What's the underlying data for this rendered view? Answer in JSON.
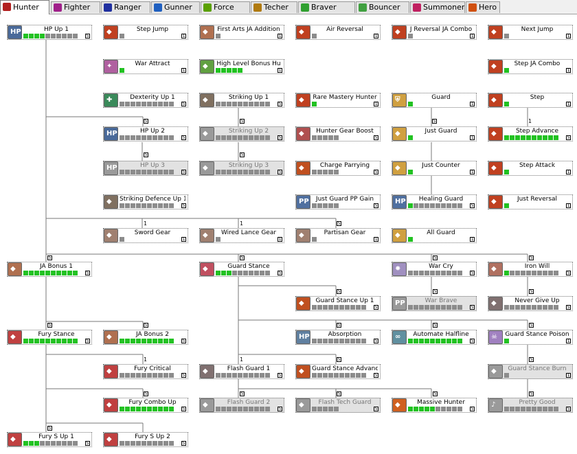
{
  "tabs": [
    {
      "label": "Hunter",
      "icon": "hunter-icon",
      "color": "#b22020",
      "active": true
    },
    {
      "label": "Fighter",
      "icon": "fighter-icon",
      "color": "#a0208a",
      "active": false
    },
    {
      "label": "Ranger",
      "icon": "ranger-icon",
      "color": "#2030a0",
      "active": false
    },
    {
      "label": "Gunner",
      "icon": "gunner-icon",
      "color": "#2060c0",
      "active": false
    },
    {
      "label": "Force",
      "icon": "force-icon",
      "color": "#5aa000",
      "active": false
    },
    {
      "label": "Techer",
      "icon": "techer-icon",
      "color": "#b07a10",
      "active": false
    },
    {
      "label": "Braver",
      "icon": "braver-icon",
      "color": "#30a030",
      "active": false
    },
    {
      "label": "Bouncer",
      "icon": "bouncer-icon",
      "color": "#40a040",
      "active": false
    },
    {
      "label": "Summoner",
      "icon": "summoner-icon",
      "color": "#c02060",
      "active": false
    },
    {
      "label": "Hero",
      "icon": "hero-icon",
      "color": "#d05010",
      "active": false
    }
  ],
  "skills": [
    {
      "name": "HP Up 1",
      "icon": "hp-up-icon",
      "color": "#4a6a9a",
      "level": 4,
      "max": 10,
      "badge": "5",
      "disabled": false
    },
    {
      "name": "Step Jump",
      "icon": "step-jump-icon",
      "color": "#c04020",
      "level": 0,
      "max": 1,
      "badge": "1",
      "disabled": false
    },
    {
      "name": "First Arts JA Addition",
      "icon": "first-arts-ja-icon",
      "color": "#b07050",
      "level": 0,
      "max": 1,
      "badge": "1",
      "disabled": false
    },
    {
      "name": "Air Reversal",
      "icon": "air-reversal-icon",
      "color": "#c04020",
      "level": 0,
      "max": 1,
      "badge": "1",
      "disabled": false
    },
    {
      "name": "J Reversal JA Combo",
      "icon": "j-reversal-ja-icon",
      "color": "#c04020",
      "level": 0,
      "max": 1,
      "badge": "1",
      "disabled": false
    },
    {
      "name": "Next Jump",
      "icon": "next-jump-icon",
      "color": "#c04020",
      "level": 0,
      "max": 1,
      "badge": "1",
      "disabled": false
    },
    {
      "name": "War Attract",
      "icon": "war-attract-icon",
      "color": "#b060a0",
      "level": 1,
      "max": 1,
      "badge": "1",
      "disabled": false
    },
    {
      "name": "High Level Bonus Hu",
      "icon": "high-level-bonus-icon",
      "color": "#60a040",
      "level": 5,
      "max": 5,
      "badge": "1",
      "disabled": false
    },
    {
      "name": "Step JA Combo",
      "icon": "step-ja-combo-icon",
      "color": "#c04020",
      "level": 1,
      "max": 1,
      "badge": "1",
      "disabled": false
    },
    {
      "name": "Dexterity Up 1",
      "icon": "dexterity-up-icon",
      "color": "#3a8a5a",
      "level": 0,
      "max": 10,
      "badge": "5",
      "disabled": false
    },
    {
      "name": "Striking Up 1",
      "icon": "striking-up-icon",
      "color": "#807060",
      "level": 0,
      "max": 10,
      "badge": "5",
      "disabled": false
    },
    {
      "name": "Rare Mastery Hunter",
      "icon": "rare-mastery-icon",
      "color": "#c04020",
      "level": 1,
      "max": 1,
      "badge": "1",
      "disabled": false
    },
    {
      "name": "Guard",
      "icon": "guard-icon",
      "color": "#d0a040",
      "level": 1,
      "max": 1,
      "badge": "1",
      "disabled": false
    },
    {
      "name": "Step",
      "icon": "step-icon",
      "color": "#c04020",
      "level": 1,
      "max": 1,
      "badge": "1",
      "disabled": false
    },
    {
      "name": "HP Up 2",
      "icon": "hp-up-icon",
      "color": "#4a6a9a",
      "level": 0,
      "max": 10,
      "badge": "5",
      "disabled": false
    },
    {
      "name": "Striking Up 2",
      "icon": "striking-up-icon",
      "color": "#807060",
      "level": 0,
      "max": 10,
      "badge": "5",
      "disabled": true
    },
    {
      "name": "Hunter Gear Boost",
      "icon": "hunter-gear-boost-icon",
      "color": "#b05050",
      "level": 0,
      "max": 5,
      "badge": "5",
      "disabled": false
    },
    {
      "name": "Just Guard",
      "icon": "just-guard-icon",
      "color": "#d0a040",
      "level": 1,
      "max": 1,
      "badge": "1",
      "disabled": false
    },
    {
      "name": "Step Advance",
      "icon": "step-advance-icon",
      "color": "#c04020",
      "level": 10,
      "max": 10,
      "badge": "5",
      "disabled": false
    },
    {
      "name": "HP Up 3",
      "icon": "hp-up-icon",
      "color": "#4a6a9a",
      "level": 0,
      "max": 10,
      "badge": "5",
      "disabled": true
    },
    {
      "name": "Striking Up 3",
      "icon": "striking-up-icon",
      "color": "#807060",
      "level": 0,
      "max": 10,
      "badge": "5",
      "disabled": true
    },
    {
      "name": "Charge Parrying",
      "icon": "charge-parrying-icon",
      "color": "#c05020",
      "level": 0,
      "max": 5,
      "badge": "5",
      "disabled": false
    },
    {
      "name": "Just Counter",
      "icon": "just-counter-icon",
      "color": "#d0a040",
      "level": 1,
      "max": 1,
      "badge": "1",
      "disabled": false
    },
    {
      "name": "Step Attack",
      "icon": "step-attack-icon",
      "color": "#c04020",
      "level": 1,
      "max": 1,
      "badge": "1",
      "disabled": false
    },
    {
      "name": "Striking Defence Up 1",
      "icon": "striking-defence-icon",
      "color": "#807060",
      "level": 0,
      "max": 10,
      "badge": "5",
      "disabled": false
    },
    {
      "name": "Just Guard PP Gain",
      "icon": "just-guard-pp-icon",
      "color": "#5070a0",
      "level": 0,
      "max": 5,
      "badge": "5",
      "disabled": false
    },
    {
      "name": "Healing Guard",
      "icon": "healing-guard-icon",
      "color": "#5070a0",
      "level": 1,
      "max": 10,
      "badge": "5",
      "disabled": false
    },
    {
      "name": "Just Reversal",
      "icon": "just-reversal-icon",
      "color": "#c04020",
      "level": 1,
      "max": 1,
      "badge": "1",
      "disabled": false
    },
    {
      "name": "Sword Gear",
      "icon": "sword-gear-icon",
      "color": "#a08070",
      "level": 0,
      "max": 1,
      "badge": "1",
      "disabled": false
    },
    {
      "name": "Wired Lance Gear",
      "icon": "wired-lance-gear-icon",
      "color": "#a08070",
      "level": 0,
      "max": 1,
      "badge": "1",
      "disabled": false
    },
    {
      "name": "Partisan Gear",
      "icon": "partisan-gear-icon",
      "color": "#a08070",
      "level": 0,
      "max": 1,
      "badge": "1",
      "disabled": false
    },
    {
      "name": "All Guard",
      "icon": "all-guard-icon",
      "color": "#d0a040",
      "level": 1,
      "max": 1,
      "badge": "1",
      "disabled": false
    },
    {
      "name": "JA Bonus 1",
      "icon": "ja-bonus-icon",
      "color": "#b07050",
      "level": 10,
      "max": 10,
      "badge": "5",
      "disabled": false
    },
    {
      "name": "Guard Stance",
      "icon": "guard-stance-icon",
      "color": "#c05060",
      "level": 3,
      "max": 10,
      "badge": "5",
      "disabled": false
    },
    {
      "name": "War Cry",
      "icon": "war-cry-icon",
      "color": "#a090c0",
      "level": 0,
      "max": 10,
      "badge": "5",
      "disabled": false
    },
    {
      "name": "Iron Will",
      "icon": "iron-will-icon",
      "color": "#b07060",
      "level": 1,
      "max": 10,
      "badge": "5",
      "disabled": false
    },
    {
      "name": "Guard Stance Up 1",
      "icon": "guard-stance-up-icon",
      "color": "#c05020",
      "level": 0,
      "max": 10,
      "badge": "5",
      "disabled": false
    },
    {
      "name": "War Brave",
      "icon": "war-brave-icon",
      "color": "#8090b0",
      "level": 0,
      "max": 10,
      "badge": "5",
      "disabled": true
    },
    {
      "name": "Never Give Up",
      "icon": "never-give-up-icon",
      "color": "#807070",
      "level": 0,
      "max": 10,
      "badge": "5",
      "disabled": false
    },
    {
      "name": "Fury Stance",
      "icon": "fury-stance-icon",
      "color": "#c04040",
      "level": 10,
      "max": 10,
      "badge": "5",
      "disabled": false
    },
    {
      "name": "JA Bonus 2",
      "icon": "ja-bonus-icon",
      "color": "#b07050",
      "level": 10,
      "max": 10,
      "badge": "5",
      "disabled": false
    },
    {
      "name": "Absorption",
      "icon": "absorption-icon",
      "color": "#6080a0",
      "level": 0,
      "max": 10,
      "badge": "5",
      "disabled": false
    },
    {
      "name": "Automate Halfline",
      "icon": "automate-halfline-icon",
      "color": "#6090a0",
      "level": 10,
      "max": 10,
      "badge": "5",
      "disabled": false
    },
    {
      "name": "Guard Stance Poison",
      "icon": "guard-stance-poison-icon",
      "color": "#a080c0",
      "level": 1,
      "max": 1,
      "badge": "1",
      "disabled": false
    },
    {
      "name": "Fury Critical",
      "icon": "fury-critical-icon",
      "color": "#c04040",
      "level": 0,
      "max": 10,
      "badge": "5",
      "disabled": false
    },
    {
      "name": "Flash Guard 1",
      "icon": "flash-guard-icon",
      "color": "#807070",
      "level": 0,
      "max": 10,
      "badge": "5",
      "disabled": false
    },
    {
      "name": "Guard Stance Advance",
      "icon": "guard-stance-advance-icon",
      "color": "#c05020",
      "level": 0,
      "max": 10,
      "badge": "5",
      "disabled": false
    },
    {
      "name": "Guard Stance Burn",
      "icon": "guard-stance-burn-icon",
      "color": "#c06080",
      "level": 0,
      "max": 1,
      "badge": "1",
      "disabled": true
    },
    {
      "name": "Fury Combo Up",
      "icon": "fury-combo-up-icon",
      "color": "#c04040",
      "level": 10,
      "max": 10,
      "badge": "5",
      "disabled": false
    },
    {
      "name": "Flash Guard 2",
      "icon": "flash-guard-icon",
      "color": "#807070",
      "level": 0,
      "max": 10,
      "badge": "5",
      "disabled": true
    },
    {
      "name": "Flash Tech Guard",
      "icon": "flash-tech-guard-icon",
      "color": "#808080",
      "level": 0,
      "max": 5,
      "badge": "5",
      "disabled": true
    },
    {
      "name": "Massive Hunter",
      "icon": "massive-hunter-icon",
      "color": "#d06020",
      "level": 5,
      "max": 10,
      "badge": "5",
      "disabled": false
    },
    {
      "name": "Pretty Good",
      "icon": "pretty-good-icon",
      "color": "#8090a0",
      "level": 0,
      "max": 10,
      "badge": "5",
      "disabled": true
    },
    {
      "name": "Fury S Up 1",
      "icon": "fury-s-up-icon",
      "color": "#c04040",
      "level": 3,
      "max": 10,
      "badge": "5",
      "disabled": false
    },
    {
      "name": "Fury S Up 2",
      "icon": "fury-s-up-icon",
      "color": "#c04040",
      "level": 0,
      "max": 10,
      "badge": "5",
      "disabled": false
    }
  ],
  "requirements": [
    "5",
    "5",
    "5",
    "5",
    "5",
    "1",
    "1",
    "1",
    "5",
    "5",
    "5",
    "5",
    "5",
    "5",
    "5",
    "5",
    "5",
    "5",
    "5",
    "5",
    "5",
    "1",
    "1",
    "5",
    "5",
    "5",
    "5",
    "5",
    "5",
    "5",
    "5"
  ]
}
